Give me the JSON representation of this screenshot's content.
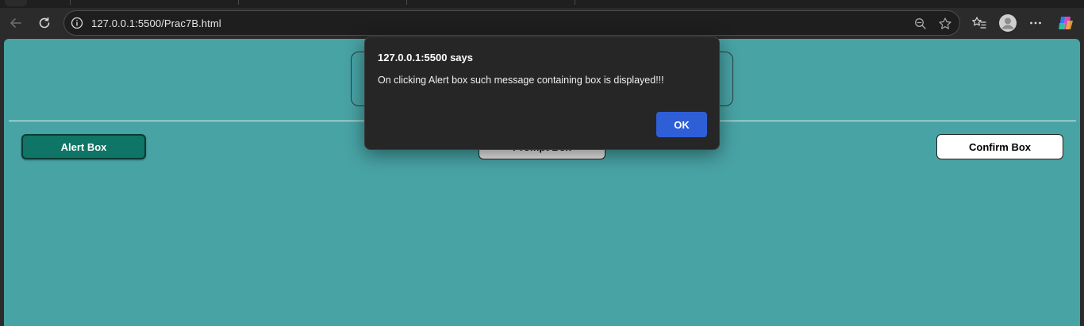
{
  "browser": {
    "url": "127.0.0.1:5500/Prac7B.html",
    "icons": [
      "back-icon",
      "reload-icon",
      "info-icon",
      "zoom-out-icon",
      "favorite-star-icon",
      "favorites-list-icon",
      "profile-avatar",
      "more-menu-icon",
      "copilot-icon"
    ]
  },
  "page": {
    "background_color": "#48a3a5",
    "buttons": {
      "alert": "Alert Box",
      "prompt": "Prompt Box",
      "confirm": "Confirm Box"
    }
  },
  "dialog": {
    "title": "127.0.0.1:5500 says",
    "message": "On clicking Alert box such message containing box is displayed!!!",
    "ok_label": "OK",
    "ok_color": "#2e5fd6"
  }
}
